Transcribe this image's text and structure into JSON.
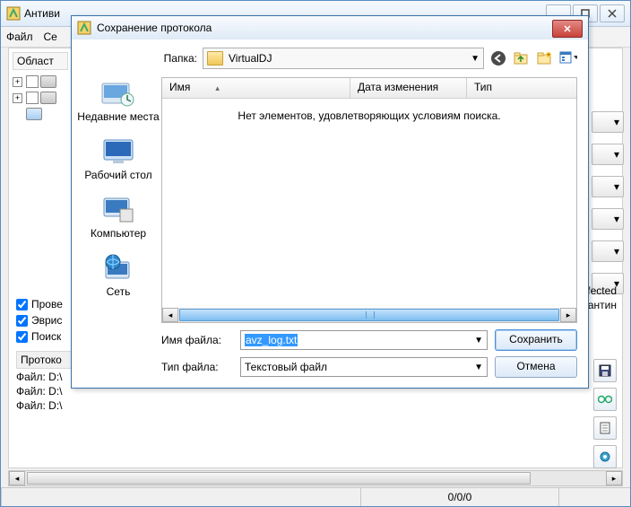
{
  "outer": {
    "title": "Антиви",
    "menu": {
      "file": "Файл",
      "se": "Се"
    },
    "group_header": "Област",
    "lower_checks": {
      "c1": "Прове",
      "c2": "Эврис",
      "c3": "Поиск"
    },
    "proto_label": "Протоко",
    "file_line": "Файл: D:\\",
    "right_text": {
      "l1": "fected",
      "l2": "антин"
    },
    "status_count": "0/0/0"
  },
  "dlg": {
    "title": "Сохранение протокола",
    "folder_label": "Папка:",
    "folder_value": "VirtualDJ",
    "columns": {
      "name": "Имя",
      "date": "Дата изменения",
      "type": "Тип"
    },
    "empty": "Нет элементов, удовлетворяющих условиям поиска.",
    "places": {
      "recent": "Недавние места",
      "desktop": "Рабочий стол",
      "computer": "Компьютер",
      "network": "Сеть"
    },
    "filename_label": "Имя файла:",
    "filename_value": "avz_log.txt",
    "filetype_label": "Тип файла:",
    "filetype_value": "Текстовый файл",
    "save": "Сохранить",
    "cancel": "Отмена"
  }
}
